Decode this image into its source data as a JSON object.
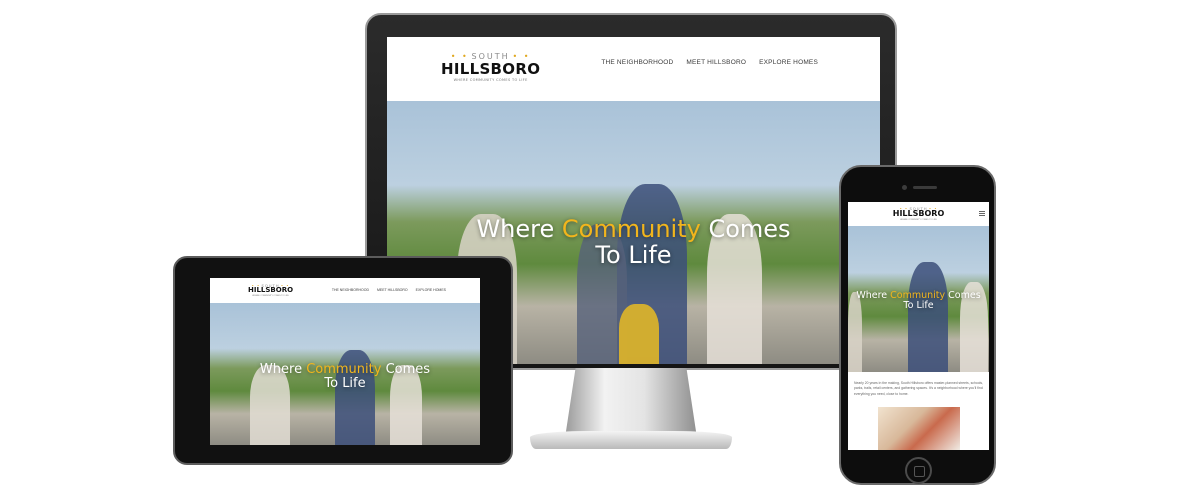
{
  "brand": {
    "logo_top": "SOUTH",
    "logo_main": "HILLSBORO",
    "logo_tagline": "WHERE COMMUNITY COMES TO LIFE"
  },
  "nav": {
    "items": [
      "THE NEIGHBORHOOD",
      "MEET HILLSBORO",
      "EXPLORE HOMES"
    ]
  },
  "hero": {
    "headline_part1": "Where ",
    "headline_accent": "Community",
    "headline_part2": " Comes",
    "headline_line2": "To Life"
  },
  "phone_content": {
    "intro": "Nearly 20 years in the making, South Hillsboro offers master-planned streets, schools, parks, trails, retail centers, and gathering spaces. It's a neighborhood where you'll find everything you need, close to home."
  },
  "colors": {
    "accent": "#f2b51c",
    "device_frame": "#111111",
    "text_dark": "#111111"
  },
  "icons": [
    "menu-icon",
    "home-button-icon",
    "camera-icon"
  ]
}
